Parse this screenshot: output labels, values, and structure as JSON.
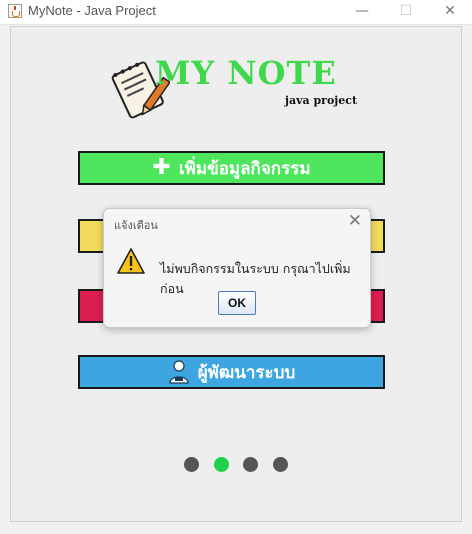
{
  "window": {
    "title": "MyNote - Java Project",
    "minimize_symbol": "—",
    "maximize_symbol": "☐",
    "close_symbol": "✕"
  },
  "logo": {
    "title": "MY NOTE",
    "subtitle": "java project",
    "icon": "notepad-pencil-icon",
    "color": "#3fd84c"
  },
  "menu": {
    "add_activity_label": "เพิ่มข้อมูลกิจกรรม",
    "add_activity_icon": "plus-icon",
    "developer_label": "ผู้พัฒนาระบบ",
    "developer_icon": "developer-person-icon",
    "colors": {
      "add": "#4de65d",
      "yellow": "#f2db5a",
      "red": "#dc1e50",
      "developer": "#3da5e0"
    }
  },
  "pagination": {
    "count": 4,
    "active_index": 1,
    "active_color": "#22d14a",
    "inactive_color": "#555555"
  },
  "dialog": {
    "title": "แจ้งเตือน",
    "message": "ไม่พบกิจกรรมในระบบ กรุณาไปเพิ่มก่อน",
    "ok_label": "OK",
    "close_symbol": "✕",
    "icon": "warning-icon"
  }
}
